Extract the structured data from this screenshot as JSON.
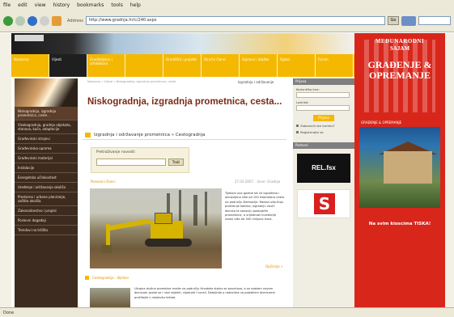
{
  "browser": {
    "menu": [
      "file",
      "edit",
      "view",
      "history",
      "bookmarks",
      "tools",
      "help"
    ],
    "address_label": "Address",
    "url": "http://www.gradnja.hr/c/240.aspx",
    "go_label": "Go",
    "status": "Done"
  },
  "site": {
    "nav": [
      {
        "label": "Naslovna",
        "active": false
      },
      {
        "label": "Vijesti",
        "active": true
      },
      {
        "label": "Graditeljstvo i arhitektura",
        "active": false
      },
      {
        "label": "",
        "active": false
      },
      {
        "label": "Gradilišta i projekti",
        "active": false
      },
      {
        "label": "Stručni članci",
        "active": false
      },
      {
        "label": "Sajmovi i izložbe",
        "active": false
      },
      {
        "label": "Oglasi",
        "active": false
      },
      {
        "label": "Forum",
        "active": false
      }
    ],
    "left_sidebar": [
      {
        "label": "Niskogradnja, izgradnja prometnica, ceste...",
        "highlight": true
      },
      {
        "label": "Visokogradnja, gradnja objekata, stanova, kuća, adaptacije",
        "highlight": false
      },
      {
        "label": "Građevinski strojevi",
        "highlight": false
      },
      {
        "label": "Građevinska oprema",
        "highlight": false
      },
      {
        "label": "Građevinski materijal",
        "highlight": false
      },
      {
        "label": "Instalacije",
        "highlight": false
      },
      {
        "label": "Energetska učinkovitost",
        "highlight": false
      },
      {
        "label": "Uređenje i održavanje okoliša",
        "highlight": false
      },
      {
        "label": "Prostorno i urbano planiranje, zaštita okoliša",
        "highlight": false
      },
      {
        "label": "Zakonodavstvo i propisi",
        "highlight": false
      },
      {
        "label": "Poslovni događaji",
        "highlight": false
      },
      {
        "label": "Trendovi na tržištu",
        "highlight": false
      }
    ],
    "main": {
      "breadcrumb_left": "Naslovna » Vijesti » Niskogradnja, izgradnja prometnica, ceste",
      "breadcrumb_right": "Izgradnja i održavanje",
      "title": "Niskogradnja, izgradnja prometnica, cesta...",
      "category_head": "Izgradnja i održavanje prometnica » Cestogradnja",
      "search_label": "Pretraživanje novosti:",
      "search_button": "Traži",
      "section1_link": "Povezani članci",
      "section1_date": "27.03.2007.  ·  Izvor: Gradnja",
      "article1_text": "Tijekom ove godine bit će izgrađeno i obnovljeno više od 150 kilometara cesta na području Dalmacije. Radovi uključuju proširenje kolnika, izgradnju novih dionica te sanaciju postojećih prometnica, a vrijednost investicije iznosi više od 300 milijuna kuna.",
      "more_link": "Opširnije »",
      "section2_link": "Cestogradnja - dijelovi",
      "article2_text": "Ukupna dužina prometne mreže na području Hrvatske stalno se povećava, a sa svakom novom dionicom grade se i novi objekti, vijadukti i tuneli. Detaljnije o radovima na pojedinim dionicama pročitajte u nastavku teksta."
    },
    "right_sidebar": {
      "login_head": "Prijava",
      "username_label": "Korisničko ime:",
      "password_label": "Lozinka:",
      "login_button": "Prijava",
      "links": [
        "Zaboravili ste lozinku?",
        "Registrirajte se"
      ],
      "partners_head": "Partneri",
      "logo1": "REL.fsx",
      "logo2": "S"
    }
  },
  "banner": {
    "line1": "MEĐUNARODNI",
    "line2": "SAJAM",
    "line3": "GRAĐENJE & OPREMANJE",
    "magazine_top": "GRAĐENJE & OPREMANJE",
    "bottom_text": "Na svim kioscima TISKA!"
  },
  "colors": {
    "nav_yellow": "#f5b800",
    "sidebar_brown": "#3d2b1f",
    "title_red": "#7a2a16",
    "banner_red": "#d8261b"
  }
}
